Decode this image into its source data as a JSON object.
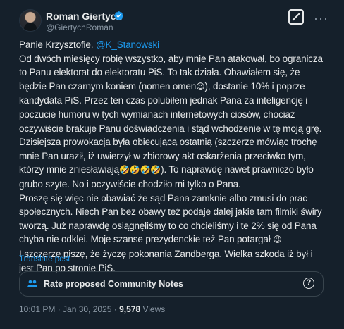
{
  "author": {
    "name": "Roman Giertych",
    "handle": "@GiertychRoman"
  },
  "post": {
    "greeting": "Panie Krzysztofie.",
    "mention": "@K_Stanowski",
    "line1": "Od dwóch miesięcy robię wszystko, aby mnie Pan atakował, bo ogranicza to Panu elektorat do elektoratu PiS. To tak działa. Obawiałem się, że będzie Pan czarnym koniem (nomen omen",
    "emoji1": "😉",
    "line1b": "), dostanie 10% i poprze kandydata PiS. Przez ten czas polubiłem jednak Pana za inteligencję i poczucie humoru w tych wymianach internetowych ciosów, chociaż oczywiście brakuje Panu doświadczenia i stąd wchodzenie w tę moją grę. Dzisiejsza prowokacja była obiecującą ostatnią (szczerze mówiąc trochę mnie Pan uraził, iż uwierzył w zbiorowy akt oskarżenia przeciwko tym, którzy mnie zniesławiają",
    "emoji2": "🤣🤣🤣🤣",
    "line1c": "). To naprawdę nawet prawniczo było grubo szyte. No i oczywiście chodziło mi tylko o Pana.",
    "line2": "Proszę  się więc nie obawiać że sąd Pana zamknie albo zmusi do prac społecznych. Niech Pan bez obawy też podaje dalej  jakie tam filmiki świry tworzą. Już naprawdę osiągnęliśmy to co chcieliśmy i te 2% się od Pana chyba nie odklei. Moje szanse prezydenckie też Pan potargał",
    "emoji3": "😉",
    "line3": "I szczerze piszę, że życzę  pokonania Zandberga. Wielka szkoda iż był i jest Pan po stronie PiS."
  },
  "translate_label": "Translate post",
  "community_notes": {
    "label": "Rate proposed Community Notes",
    "help": "?"
  },
  "meta": {
    "timestamp": "10:01 PM · Jan 30, 2025 · ",
    "views_count": "9,578",
    "views_label": " Views"
  },
  "colors": {
    "background": "#15202b",
    "accent": "#1d9bf0",
    "text": "#e7e9ea",
    "muted": "#8b98a5"
  },
  "icons": [
    "avatar",
    "verified-badge-icon",
    "grok-icon",
    "more-icon",
    "community-notes-icon",
    "help-icon"
  ]
}
